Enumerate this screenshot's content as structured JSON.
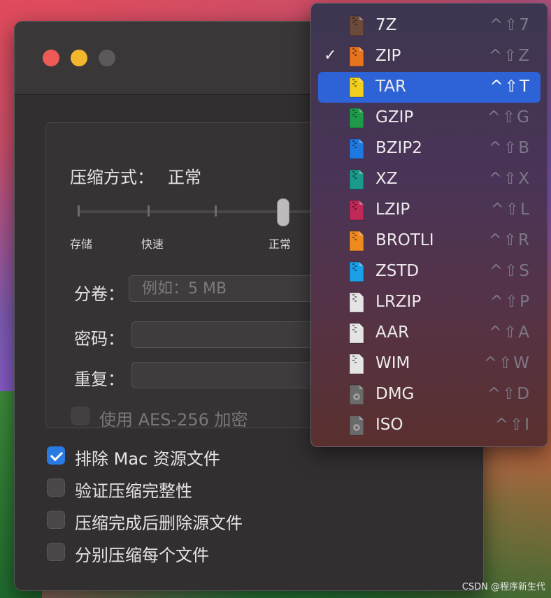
{
  "window": {
    "compression_label": "压缩方式：",
    "compression_value": "正常",
    "slider_labels": [
      "存储",
      "快速",
      "正常"
    ],
    "split_label": "分卷：",
    "split_placeholder": "例如：5 MB",
    "password_label": "密码：",
    "repeat_label": "重复：",
    "aes_label": "使用 AES-256 加密",
    "options": [
      {
        "label": "排除 Mac 资源文件",
        "checked": true
      },
      {
        "label": "验证压缩完整性",
        "checked": false
      },
      {
        "label": "压缩完成后删除源文件",
        "checked": false
      },
      {
        "label": "分别压缩每个文件",
        "checked": false
      }
    ]
  },
  "format_menu": {
    "items": [
      {
        "label": "7Z",
        "shortcut": "^⇧7",
        "icon_color": "#6b4a3a",
        "checked": false,
        "selected": false
      },
      {
        "label": "ZIP",
        "shortcut": "^⇧Z",
        "icon_color": "#e8731e",
        "checked": true,
        "selected": false
      },
      {
        "label": "TAR",
        "shortcut": "^⇧T",
        "icon_color": "#f2cf1d",
        "checked": false,
        "selected": true
      },
      {
        "label": "GZIP",
        "shortcut": "^⇧G",
        "icon_color": "#1e9a4a",
        "checked": false,
        "selected": false
      },
      {
        "label": "BZIP2",
        "shortcut": "^⇧B",
        "icon_color": "#1e7ae0",
        "checked": false,
        "selected": false
      },
      {
        "label": "XZ",
        "shortcut": "^⇧X",
        "icon_color": "#1a9a8a",
        "checked": false,
        "selected": false
      },
      {
        "label": "LZIP",
        "shortcut": "^⇧L",
        "icon_color": "#c02858",
        "checked": false,
        "selected": false
      },
      {
        "label": "BROTLI",
        "shortcut": "^⇧R",
        "icon_color": "#ee8a1e",
        "checked": false,
        "selected": false
      },
      {
        "label": "ZSTD",
        "shortcut": "^⇧S",
        "icon_color": "#1aa0e8",
        "checked": false,
        "selected": false
      },
      {
        "label": "LRZIP",
        "shortcut": "^⇧P",
        "icon_color": "#e4e4e4",
        "checked": false,
        "selected": false
      },
      {
        "label": "AAR",
        "shortcut": "^⇧A",
        "icon_color": "#e4e4e4",
        "checked": false,
        "selected": false
      },
      {
        "label": "WIM",
        "shortcut": "^⇧W",
        "icon_color": "#e4e4e4",
        "checked": false,
        "selected": false
      },
      {
        "label": "DMG",
        "shortcut": "^⇧D",
        "icon_color": "#6a6a6a",
        "checked": false,
        "selected": false
      },
      {
        "label": "ISO",
        "shortcut": "^⇧I",
        "icon_color": "#6a6a6a",
        "checked": false,
        "selected": false
      }
    ]
  },
  "check_glyph": "✓",
  "watermark": "CSDN @程序新生代"
}
